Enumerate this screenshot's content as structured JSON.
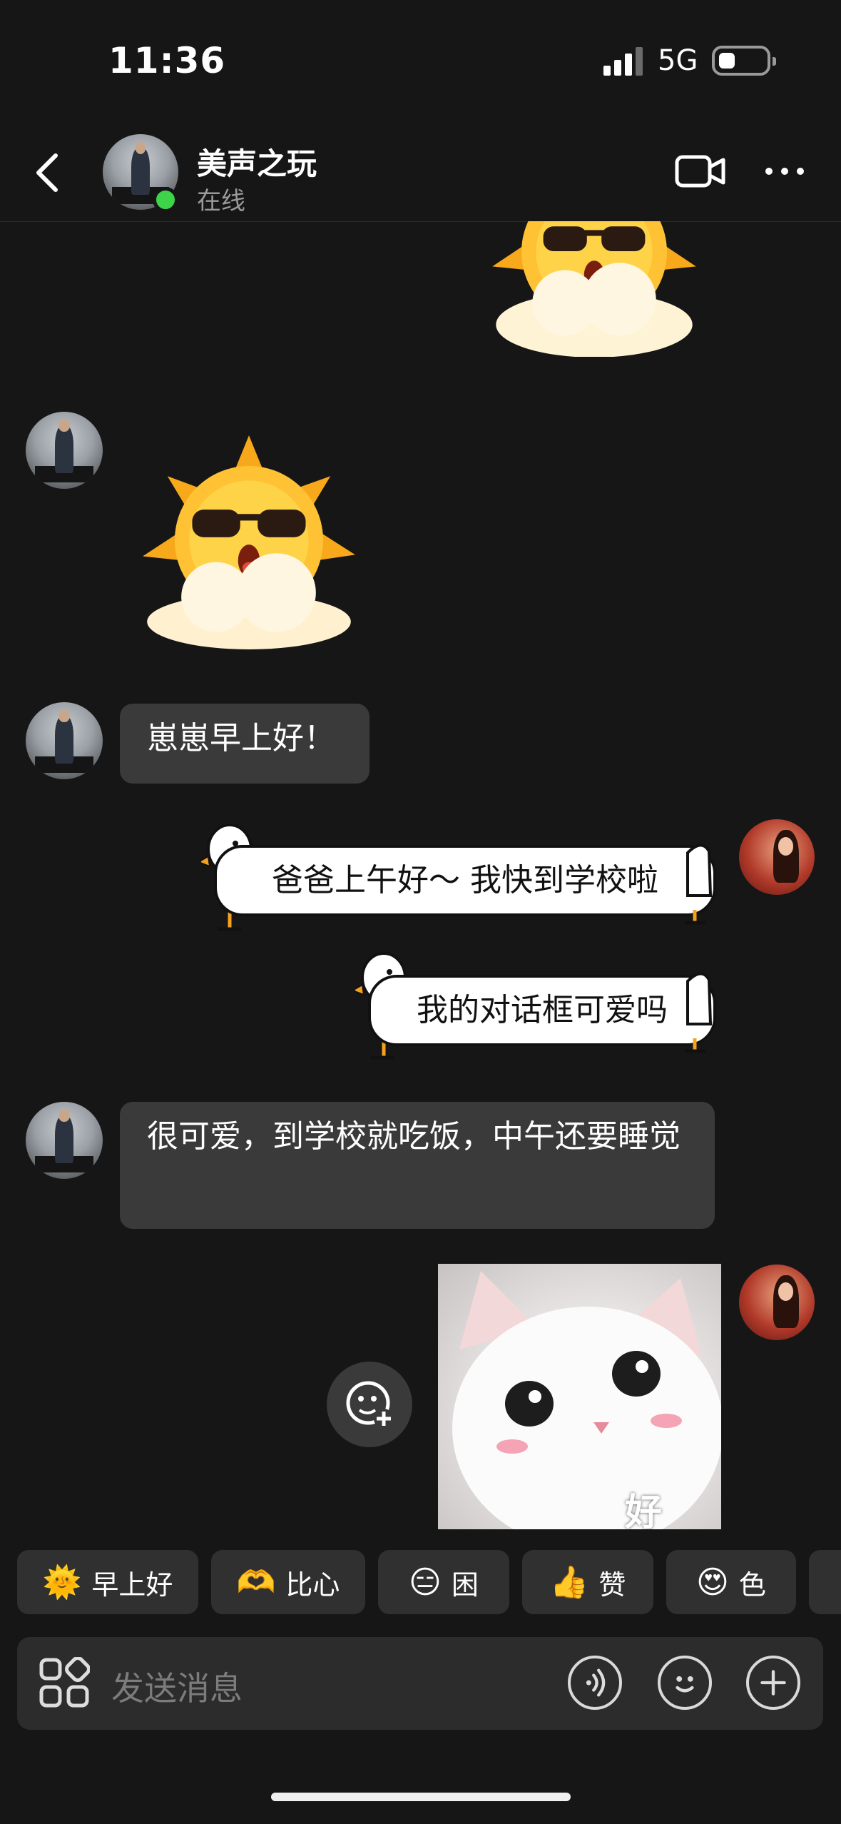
{
  "status_bar": {
    "time": "11:36",
    "network": "5G"
  },
  "header": {
    "back_icon": "chevron-left-icon",
    "contact_name": "美声之玩",
    "contact_status": "在线",
    "video_icon": "video-camera-icon",
    "more_icon": "more-dots-icon"
  },
  "messages": [
    {
      "side": "right",
      "type": "sticker",
      "sticker": "sun-with-sunglasses"
    },
    {
      "side": "left",
      "type": "sticker",
      "sticker": "sun-with-sunglasses"
    },
    {
      "side": "left",
      "type": "text",
      "text": "崽崽早上好！"
    },
    {
      "side": "right",
      "type": "goose-bubble",
      "text": "爸爸上午好～ 我快到学校啦"
    },
    {
      "side": "right",
      "type": "goose-bubble",
      "text": "我的对话框可爱吗"
    },
    {
      "side": "left",
      "type": "text",
      "text": "很可爱，到学校就吃饭，中午还要睡觉"
    },
    {
      "side": "right",
      "type": "image",
      "caption": "好"
    }
  ],
  "quick_replies": [
    {
      "emoji": "🌞",
      "label": "早上好"
    },
    {
      "emoji": "🫶",
      "label": "比心"
    },
    {
      "emoji": "😑",
      "label": "困"
    },
    {
      "emoji": "👍",
      "label": "赞"
    },
    {
      "emoji": "😍",
      "label": "色"
    }
  ],
  "input": {
    "placeholder": "发送消息"
  },
  "colors": {
    "background": "#161616",
    "bubble_left": "#3a3a3a",
    "online": "#3ed44a"
  }
}
